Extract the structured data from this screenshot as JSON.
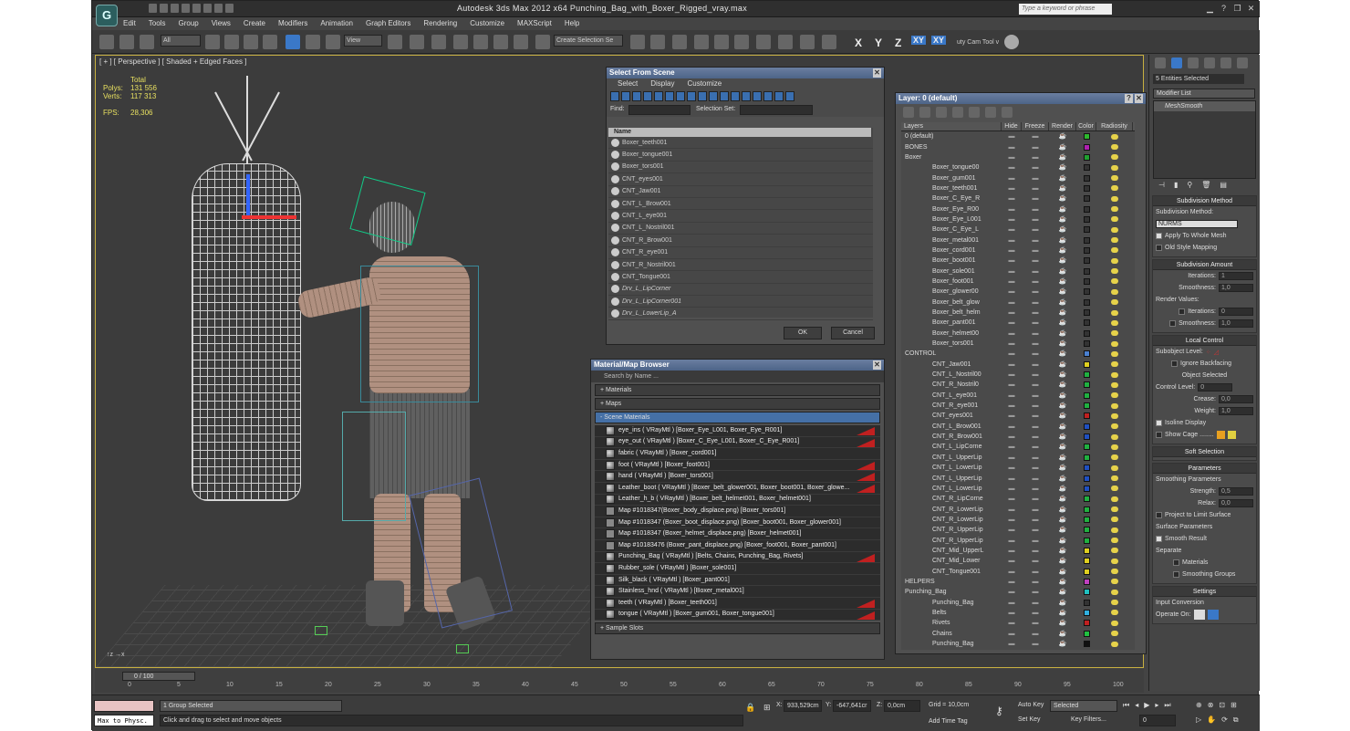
{
  "app": {
    "title": "Autodesk 3ds Max  2012 x64      Punching_Bag_with_Boxer_Rigged_vray.max",
    "search_placeholder": "Type a keyword or phrase",
    "logo": "3ds-max-logo-icon"
  },
  "menu": [
    "Edit",
    "Tools",
    "Group",
    "Views",
    "Create",
    "Modifiers",
    "Animation",
    "Graph Editors",
    "Rendering",
    "Customize",
    "MAXScript",
    "Help"
  ],
  "toolbar": {
    "filter": "All",
    "ref_coord": "View",
    "selection_set": "Create Selection Se",
    "axes": [
      "X",
      "Y",
      "Z",
      "XY",
      "XY"
    ],
    "camtool": "uty Cam Tool v"
  },
  "viewport": {
    "label": "[ + ] [ Perspective ] [ Shaded + Edged Faces ]",
    "stats": {
      "total_label": "Total",
      "polys_label": "Polys:",
      "polys": "131 556",
      "verts_label": "Verts:",
      "verts": "117 313",
      "fps_label": "FPS:",
      "fps": "28,306"
    }
  },
  "select_from_scene": {
    "title": "Select From Scene",
    "menu": [
      "Select",
      "Display",
      "Customize"
    ],
    "find_label": "Find:",
    "selection_set_label": "Selection Set:",
    "column": "Name",
    "items": [
      "Boxer_teeth001",
      "Boxer_tongue001",
      "Boxer_tors001",
      "CNT_eyes001",
      "CNT_Jaw001",
      "CNT_L_Brow001",
      "CNT_L_eye001",
      "CNT_L_Nostril001",
      "CNT_R_Brow001",
      "CNT_R_eye001",
      "CNT_R_Nostril001",
      "CNT_Tongue001",
      "Drv_L_LipCorner",
      "Drv_L_LipCorner001",
      "Drv_L_LowerLip_A"
    ],
    "ok": "OK",
    "cancel": "Cancel"
  },
  "material_browser": {
    "title": "Material/Map Browser",
    "search": "Search by Name ...",
    "sections": [
      "+ Materials",
      "+ Maps",
      "- Scene Materials"
    ],
    "items": [
      "eye_ins  ( VRayMtl ) [Boxer_Eye_L001, Boxer_Eye_R001]",
      "eye_out  ( VRayMtl ) [Boxer_C_Eye_L001, Boxer_C_Eye_R001]",
      "fabric  ( VRayMtl ) [Boxer_cord001]",
      "foot  ( VRayMtl ) [Boxer_foot001]",
      "hand  ( VRayMtl ) [Boxer_tors001]",
      "Leather_boot  ( VRayMtl ) [Boxer_belt_glower001, Boxer_boot001, Boxer_glowe...",
      "Leather_h_b  ( VRayMtl ) [Boxer_belt_helmet001, Boxer_helmet001]",
      "Map #1018347(Boxer_body_displace.png) [Boxer_tors001]",
      "Map #1018347 (Boxer_boot_displace.png) [Boxer_boot001, Boxer_glower001]",
      "Map #1018347 (Boxer_helmet_displace.png) [Boxer_helmet001]",
      "Map #10183476 (Boxer_pant_displace.png) [Boxer_foot001, Boxer_pant001]",
      "Punching_Bag  ( VRayMtl ) [Belts, Chains, Punching_Bag, Rivets]",
      "Rubber_sole  ( VRayMtl ) [Boxer_sole001]",
      "Silk_black  ( VRayMtl ) [Boxer_pant001]",
      "Stainless_hnd  ( VRayMtl ) [Boxer_metal001]",
      "teeth  ( VRayMtl ) [Boxer_teeth001]",
      "tongue  ( VRayMtl ) [Boxer_gum001, Boxer_tongue001]"
    ],
    "sample_slots": "+ Sample Slots"
  },
  "layers": {
    "title": "Layer: 0 (default)",
    "columns": [
      "Layers",
      "Hide",
      "Freeze",
      "Render",
      "Color",
      "Radiosity"
    ],
    "rows": [
      {
        "n": "0 (default)",
        "c": "#2db82d"
      },
      {
        "n": "BONES",
        "c": "#b020b0"
      },
      {
        "n": "Boxer",
        "c": "#20a030"
      },
      {
        "n": "Boxer_tongue00",
        "c": "#333"
      },
      {
        "n": "Boxer_gum001",
        "c": "#333"
      },
      {
        "n": "Boxer_teeth001",
        "c": "#333"
      },
      {
        "n": "Boxer_C_Eye_R",
        "c": "#333"
      },
      {
        "n": "Boxer_Eye_R00",
        "c": "#333"
      },
      {
        "n": "Boxer_Eye_L001",
        "c": "#333"
      },
      {
        "n": "Boxer_C_Eye_L",
        "c": "#333"
      },
      {
        "n": "Boxer_metal001",
        "c": "#333"
      },
      {
        "n": "Boxer_cord001",
        "c": "#333"
      },
      {
        "n": "Boxer_boot001",
        "c": "#333"
      },
      {
        "n": "Boxer_sole001",
        "c": "#333"
      },
      {
        "n": "Boxer_foot001",
        "c": "#333"
      },
      {
        "n": "Boxer_glower00",
        "c": "#333"
      },
      {
        "n": "Boxer_belt_glow",
        "c": "#333"
      },
      {
        "n": "Boxer_belt_helm",
        "c": "#333"
      },
      {
        "n": "Boxer_pant001",
        "c": "#333"
      },
      {
        "n": "Boxer_helmet00",
        "c": "#333"
      },
      {
        "n": "Boxer_tors001",
        "c": "#333"
      },
      {
        "n": "CONTROL",
        "c": "#4a80d0"
      },
      {
        "n": "CNT_Jaw001",
        "c": "#e0d020"
      },
      {
        "n": "CNT_L_Nostril00",
        "c": "#20b040"
      },
      {
        "n": "CNT_R_Nostril0",
        "c": "#20b040"
      },
      {
        "n": "CNT_L_eye001",
        "c": "#20b040"
      },
      {
        "n": "CNT_R_eye001",
        "c": "#20b040"
      },
      {
        "n": "CNT_eyes001",
        "c": "#c02020"
      },
      {
        "n": "CNT_L_Brow001",
        "c": "#2050c0"
      },
      {
        "n": "CNT_R_Brow001",
        "c": "#2050c0"
      },
      {
        "n": "CNT_L_LipCorne",
        "c": "#20b040"
      },
      {
        "n": "CNT_L_UpperLip",
        "c": "#20b040"
      },
      {
        "n": "CNT_L_LowerLip",
        "c": "#2050c0"
      },
      {
        "n": "CNT_L_UpperLip",
        "c": "#2050c0"
      },
      {
        "n": "CNT_L_LowerLip",
        "c": "#2050c0"
      },
      {
        "n": "CNT_R_LipCorne",
        "c": "#20b040"
      },
      {
        "n": "CNT_R_LowerLip",
        "c": "#20b040"
      },
      {
        "n": "CNT_R_LowerLip",
        "c": "#20b040"
      },
      {
        "n": "CNT_R_UpperLip",
        "c": "#20b040"
      },
      {
        "n": "CNT_R_UpperLip",
        "c": "#20b040"
      },
      {
        "n": "CNT_Mid_UpperL",
        "c": "#e0d020"
      },
      {
        "n": "CNT_Mid_Lower",
        "c": "#e0d020"
      },
      {
        "n": "CNT_Tongue001",
        "c": "#e0d020"
      },
      {
        "n": "HELPERS",
        "c": "#c040c0"
      },
      {
        "n": "Punching_Bag",
        "c": "#20c0c0"
      },
      {
        "n": "Punching_Bag",
        "c": "#333"
      },
      {
        "n": "Belts",
        "c": "#30b0e0"
      },
      {
        "n": "Rivets",
        "c": "#c02020"
      },
      {
        "n": "Chains",
        "c": "#20c040"
      },
      {
        "n": "Punching_Bag",
        "c": "#111"
      }
    ]
  },
  "command_panel": {
    "selection": "5 Entities Selected",
    "modifier_list": "Modifier List",
    "stack_item": "MeshSmooth",
    "subdivision_method": "Subdivision Method",
    "subdivision_method_label": "Subdivision Method:",
    "method_value": "NURMS",
    "apply_whole": "Apply To Whole Mesh",
    "old_style": "Old Style Mapping",
    "subdivision_amount": "Subdivision Amount",
    "iterations_label": "Iterations:",
    "iterations": "1",
    "smoothness_label": "Smoothness:",
    "smoothness": "1,0",
    "render_values": "Render Values:",
    "r_iterations": "0",
    "r_smoothness": "1,0",
    "local_control": "Local Control",
    "subobject": "Subobject Level:",
    "ignore_backfacing": "Ignore Backfacing",
    "object_selected": "Object Selected",
    "control_level": "Control Level:",
    "control_level_v": "0",
    "crease": "Crease:",
    "crease_v": "0,0",
    "weight": "Weight:",
    "weight_v": "1,0",
    "isoline": "Isoline Display",
    "show_cage": "Show Cage ........",
    "soft_selection": "Soft Selection",
    "parameters": "Parameters",
    "smoothing_params": "Smoothing Parameters",
    "strength": "Strength:",
    "strength_v": "0,5",
    "relax": "Relax:",
    "relax_v": "0,0",
    "project": "Project to Limit Surface",
    "surface_params": "Surface Parameters",
    "smooth_result": "Smooth Result",
    "separate": "Separate",
    "materials": "Materials",
    "smoothing_groups": "Smoothing Groups",
    "settings": "Settings",
    "input_conversion": "Input Conversion",
    "operate_on": "Operate On:"
  },
  "timeline": {
    "slider": "0 / 100",
    "ticks": [
      "0",
      "5",
      "10",
      "15",
      "20",
      "25",
      "30",
      "35",
      "40",
      "45",
      "50",
      "55",
      "60",
      "65",
      "70",
      "75",
      "80",
      "85",
      "90",
      "95",
      "100"
    ]
  },
  "status": {
    "maxscript": "Max to Physc.",
    "group": "1 Group Selected",
    "hint": "Click and drag to select and move objects",
    "x_label": "X:",
    "x": "933,529cm",
    "y_label": "Y:",
    "y": "-647,641cr",
    "z_label": "Z:",
    "z": "0,0cm",
    "grid": "Grid = 10,0cm",
    "add_time_tag": "Add Time Tag",
    "auto_key": "Auto Key",
    "set_key": "Set Key",
    "selected": "Selected",
    "key_filters": "Key Filters...",
    "frame": "0"
  }
}
